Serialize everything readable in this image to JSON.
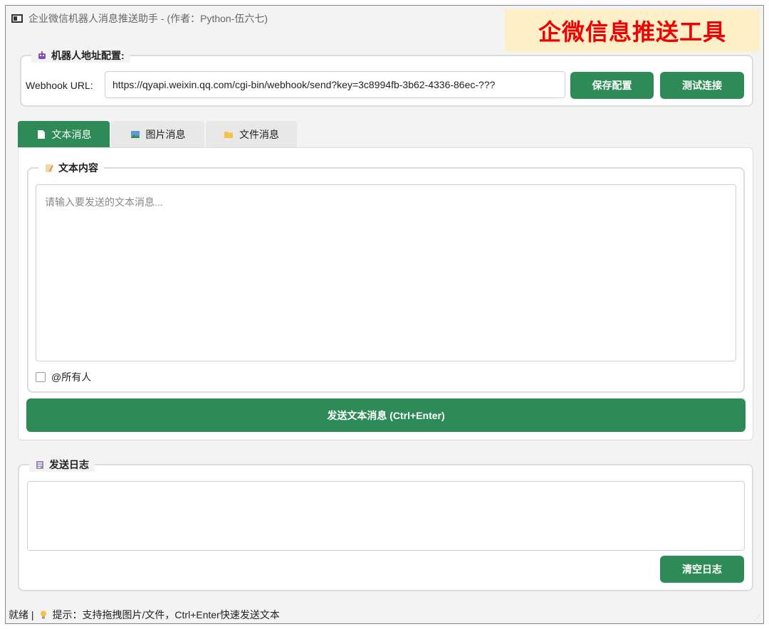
{
  "window": {
    "title": "企业微信机器人消息推送助手 - (作者：Python-伍六七)"
  },
  "banner": {
    "text": "企微信息推送工具",
    "color": "#f00000",
    "background": "#fdf0c8"
  },
  "robot_config": {
    "title": "机器人地址配置:",
    "url_label": "Webhook URL:",
    "url_value": "https://qyapi.weixin.qq.com/cgi-bin/webhook/send?key=3c8994fb-3b62-4336-86ec-???",
    "save_label": "保存配置",
    "test_label": "测试连接"
  },
  "tabs": [
    {
      "label": "文本消息",
      "icon": "document-icon",
      "active": true
    },
    {
      "label": "图片消息",
      "icon": "image-icon",
      "active": false
    },
    {
      "label": "文件消息",
      "icon": "folder-icon",
      "active": false
    }
  ],
  "text_content": {
    "title": "文本内容",
    "placeholder": "请输入要发送的文本消息...",
    "mention_all_label": "@所有人",
    "mention_all_checked": false,
    "send_label": "发送文本消息 (Ctrl+Enter)"
  },
  "log": {
    "title": "发送日志",
    "clear_label": "清空日志"
  },
  "status": {
    "state": "就绪 |",
    "tip": "提示：支持拖拽图片/文件，Ctrl+Enter快速发送文本"
  },
  "colors": {
    "accent": "#2e8b57",
    "window_bg": "#f3f3f3"
  }
}
